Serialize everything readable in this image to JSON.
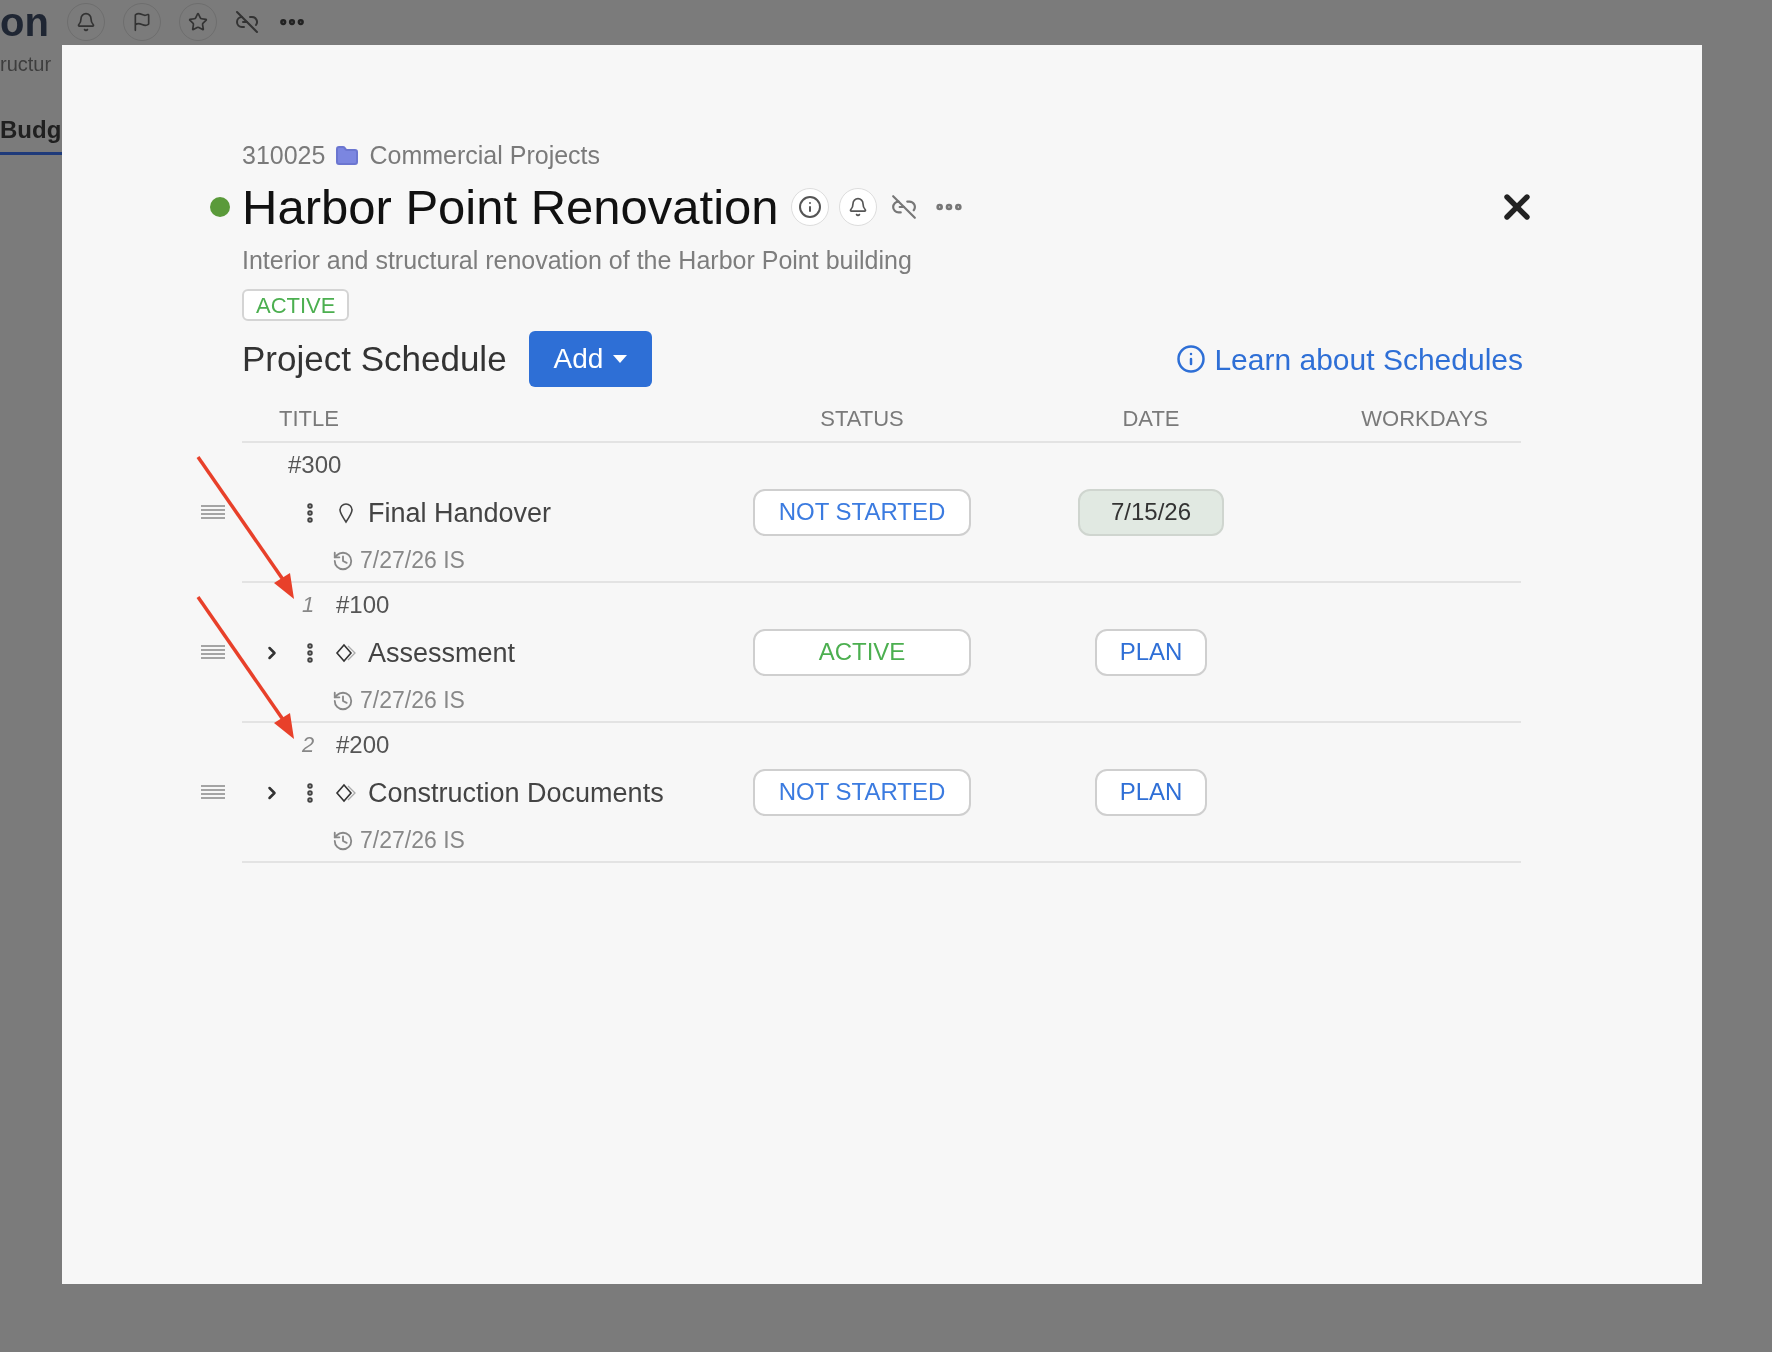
{
  "background_page": {
    "title_fragment": "on",
    "subtitle_fragment": "ructur",
    "tab_fragment": "Budg"
  },
  "project": {
    "number": "310025",
    "folder": "Commercial Projects",
    "title": "Harbor Point Renovation",
    "description": "Interior and structural renovation of the Harbor Point building",
    "status": "ACTIVE"
  },
  "schedule": {
    "title": "Project Schedule",
    "add_button": "Add",
    "learn_link": "Learn about Schedules",
    "columns": [
      "TITLE",
      "STATUS",
      "DATE",
      "WORKDAYS"
    ],
    "rows": [
      {
        "number": "#300",
        "kind": "milestone",
        "expandable": false,
        "title": "Final Handover",
        "updated": "7/27/26 IS",
        "status": {
          "label": "NOT STARTED",
          "kind": "not_started"
        },
        "date": {
          "label": "7/15/26",
          "kind": "date"
        }
      },
      {
        "order": "1",
        "number": "#100",
        "kind": "phase",
        "expandable": true,
        "title": "Assessment",
        "updated": "7/27/26 IS",
        "status": {
          "label": "ACTIVE",
          "kind": "active"
        },
        "date": {
          "label": "PLAN",
          "kind": "plan"
        }
      },
      {
        "order": "2",
        "number": "#200",
        "kind": "phase",
        "expandable": true,
        "title": "Construction Documents",
        "updated": "7/27/26 IS",
        "status": {
          "label": "NOT STARTED",
          "kind": "not_started"
        },
        "date": {
          "label": "PLAN",
          "kind": "plan"
        }
      }
    ]
  }
}
